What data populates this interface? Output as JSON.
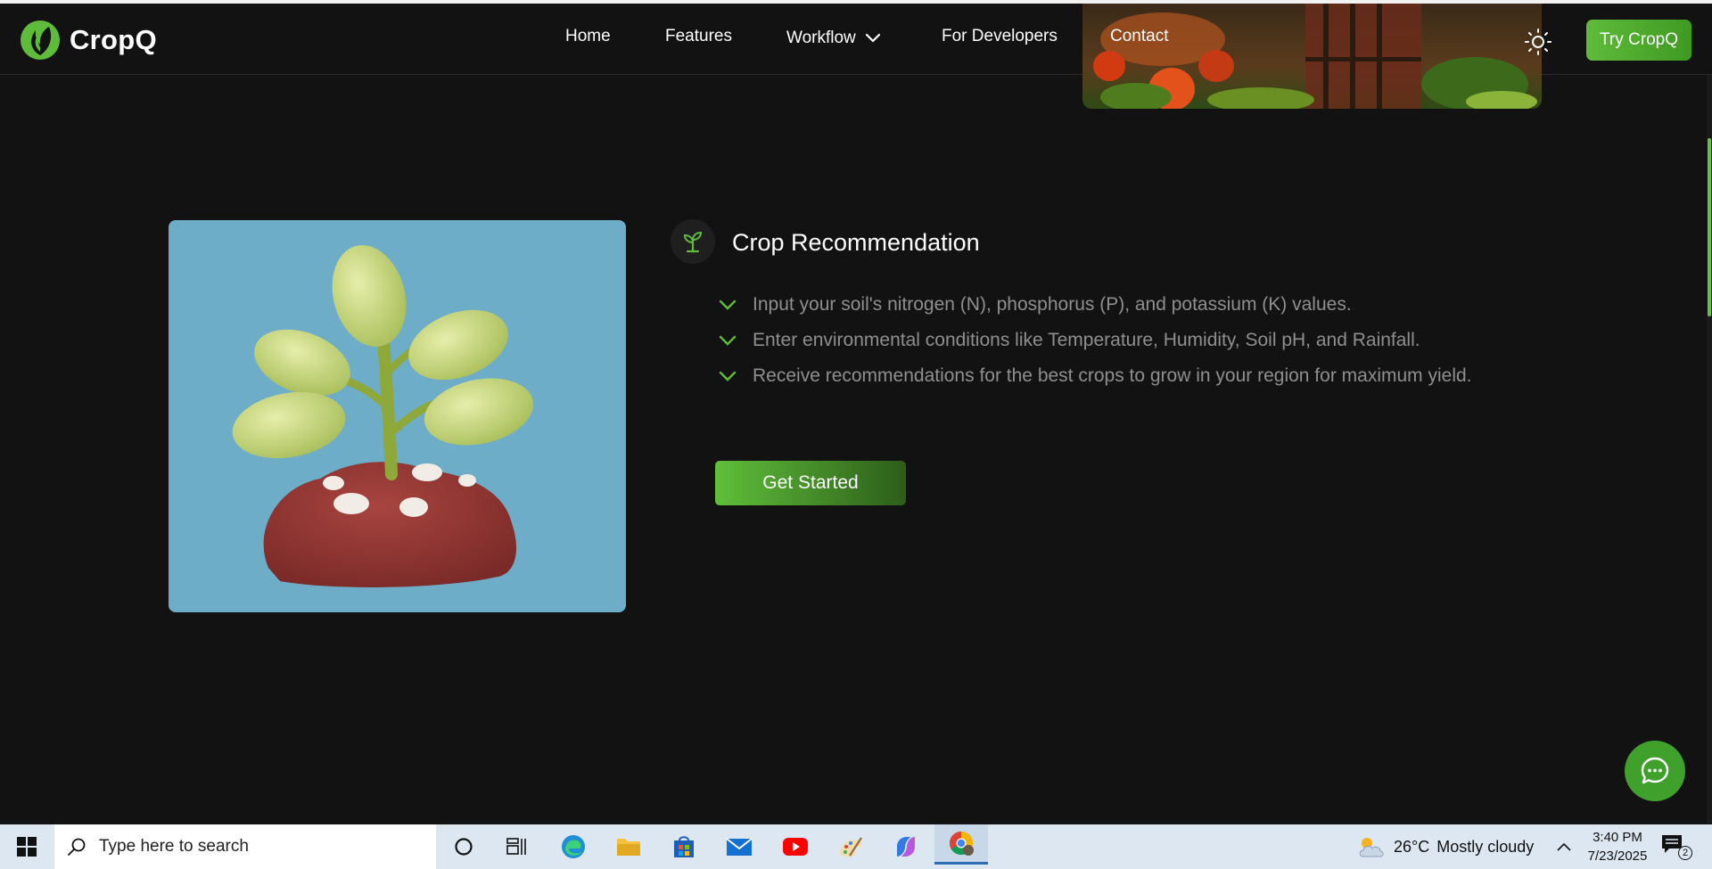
{
  "brand": {
    "name": "CropQ"
  },
  "nav": {
    "home": "Home",
    "features": "Features",
    "workflow": "Workflow",
    "developers": "For Developers",
    "contact": "Contact",
    "try_button": "Try CropQ"
  },
  "feature": {
    "title": "Crop Recommendation",
    "items": [
      "Input your soil's nitrogen (N), phosphorus (P), and potassium (K) values.",
      "Enter environmental conditions like Temperature, Humidity, Soil pH, and Rainfall.",
      "Receive recommendations for the best crops to grow in your region for maximum yield."
    ],
    "cta": "Get Started"
  },
  "taskbar": {
    "search_placeholder": "Type here to search",
    "weather_temp": "26°C",
    "weather_text": "Mostly cloudy",
    "time": "3:40 PM",
    "date": "7/23/2025",
    "notification_count": "2"
  },
  "colors": {
    "accent": "#5fbb3a",
    "background": "#121212",
    "muted_text": "#8f8f8f",
    "image_bg": "#6eadc8"
  },
  "icons": {
    "logo": "leaf-logo-icon",
    "theme": "sun-icon",
    "feature": "seedling-icon",
    "check": "check-icon",
    "chat": "chat-bubble-icon"
  }
}
